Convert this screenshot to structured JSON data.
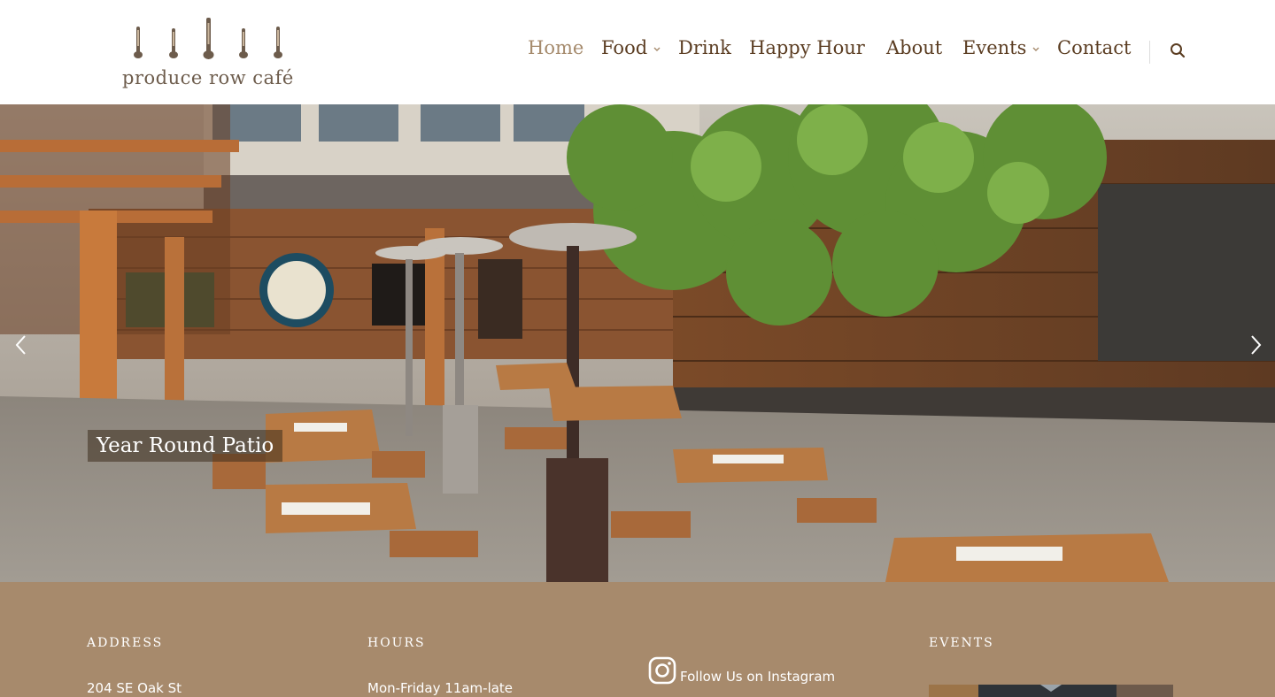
{
  "brand": {
    "logo_text": "produce row café"
  },
  "nav": {
    "items": [
      {
        "label": "Home",
        "active": true,
        "dropdown": false
      },
      {
        "label": "Food",
        "active": false,
        "dropdown": true
      },
      {
        "label": "Drink",
        "active": false,
        "dropdown": false
      },
      {
        "label": "Happy Hour",
        "active": false,
        "dropdown": false
      },
      {
        "label": "About",
        "active": false,
        "dropdown": false
      },
      {
        "label": "Events",
        "active": false,
        "dropdown": true
      },
      {
        "label": "Contact",
        "active": false,
        "dropdown": false
      }
    ],
    "search_icon": "search-icon"
  },
  "hero": {
    "caption": "Year Round Patio",
    "prev_icon": "chevron-left-icon",
    "next_icon": "chevron-right-icon"
  },
  "footer": {
    "address": {
      "title": "ADDRESS",
      "line1": "204 SE Oak St"
    },
    "hours": {
      "title": "HOURS",
      "line1": "Mon-Friday 11am-late"
    },
    "instagram": {
      "icon": "instagram-icon",
      "label": "Follow Us on Instagram"
    },
    "events": {
      "title": "EVENTS"
    }
  },
  "colors": {
    "nav_text": "#5b3d22",
    "nav_active": "#a58a6c",
    "footer_bg": "#a78a6c"
  }
}
